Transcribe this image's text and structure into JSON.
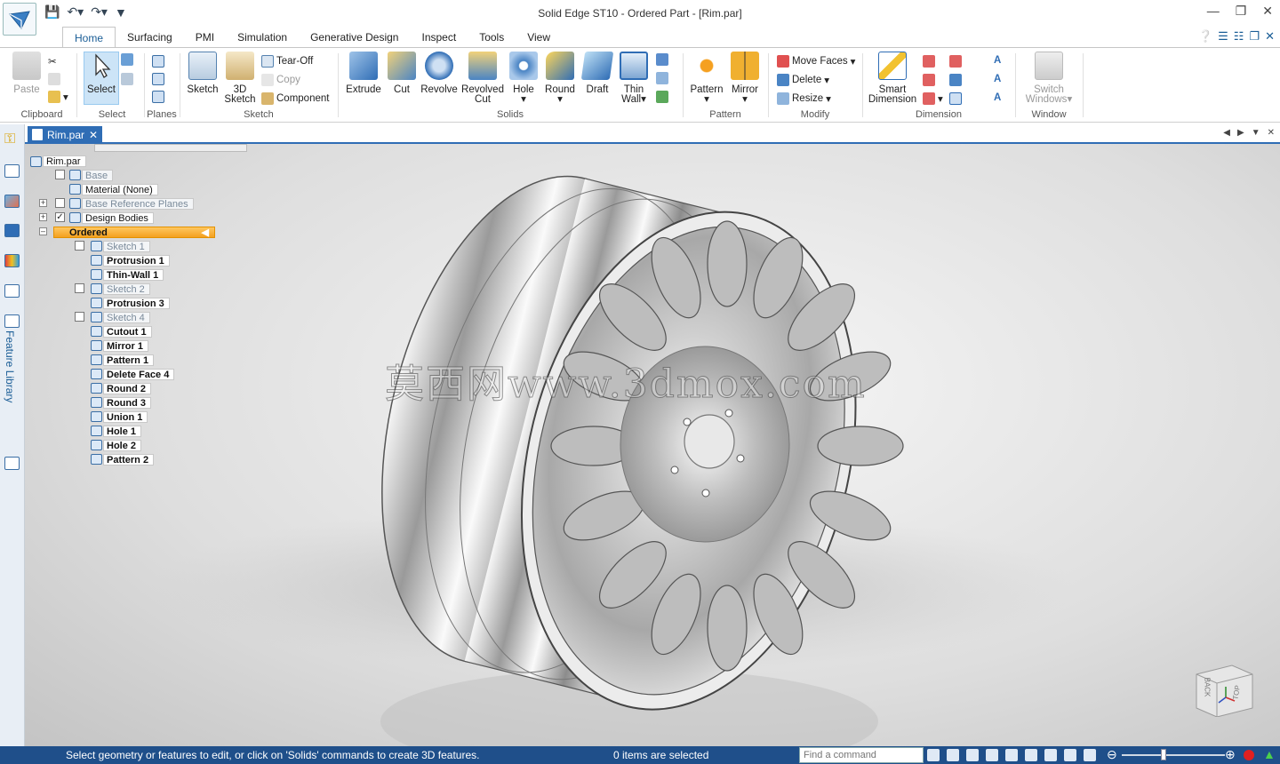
{
  "window": {
    "title": "Solid Edge ST10 - Ordered Part - [Rim.par]"
  },
  "ribbon_tabs": [
    "Home",
    "Surfacing",
    "PMI",
    "Simulation",
    "Generative Design",
    "Inspect",
    "Tools",
    "View"
  ],
  "ribbon": {
    "clipboard": {
      "paste": "Paste",
      "label": "Clipboard"
    },
    "select": {
      "select": "Select",
      "label": "Select"
    },
    "planes": {
      "label": "Planes"
    },
    "sketch": {
      "sketch": "Sketch",
      "sketch3d_1": "3D",
      "sketch3d_2": "Sketch",
      "tearoff": "Tear-Off",
      "copy": "Copy",
      "component": "Component",
      "label": "Sketch"
    },
    "solids": {
      "extrude": "Extrude",
      "cut": "Cut",
      "revolve": "Revolve",
      "revolved_cut_1": "Revolved",
      "revolved_cut_2": "Cut",
      "hole": "Hole",
      "round": "Round",
      "draft": "Draft",
      "thin_wall_1": "Thin",
      "thin_wall_2": "Wall",
      "label": "Solids"
    },
    "pattern": {
      "pattern": "Pattern",
      "mirror": "Mirror",
      "label": "Pattern"
    },
    "modify": {
      "move_faces": "Move Faces",
      "delete": "Delete",
      "resize": "Resize",
      "label": "Modify"
    },
    "dimension": {
      "smart_1": "Smart",
      "smart_2": "Dimension",
      "label": "Dimension"
    },
    "window": {
      "switch_1": "Switch",
      "switch_2": "Windows",
      "label": "Window"
    }
  },
  "left_bar": {
    "feature_library": "Feature Library"
  },
  "document_tab": "Rim.par",
  "tree": {
    "root": "Rim.par",
    "base": "Base",
    "material": "Material (None)",
    "base_ref_planes": "Base Reference Planes",
    "design_bodies": "Design Bodies",
    "ordered": "Ordered",
    "items": [
      "Sketch 1",
      "Protrusion 1",
      "Thin-Wall 1",
      "Sketch 2",
      "Protrusion 3",
      "Sketch 4",
      "Cutout 1",
      "Mirror 1",
      "Pattern 1",
      "Delete Face 4",
      "Round 2",
      "Round 3",
      "Union 1",
      "Hole 1",
      "Hole 2",
      "Pattern 2"
    ]
  },
  "viewport": {
    "watermark": "莫西网www.3dmox.com",
    "viewcube_back": "BACK",
    "viewcube_top": "TOP"
  },
  "status": {
    "message": "Select geometry or features to edit, or click on 'Solids' commands to create 3D features.",
    "selection": "0 items are selected",
    "command_placeholder": "Find a command"
  },
  "colors": {
    "accent": "#2f6db5",
    "statusbar": "#1f4f8a",
    "ordered_highlight": "#f4a020"
  }
}
